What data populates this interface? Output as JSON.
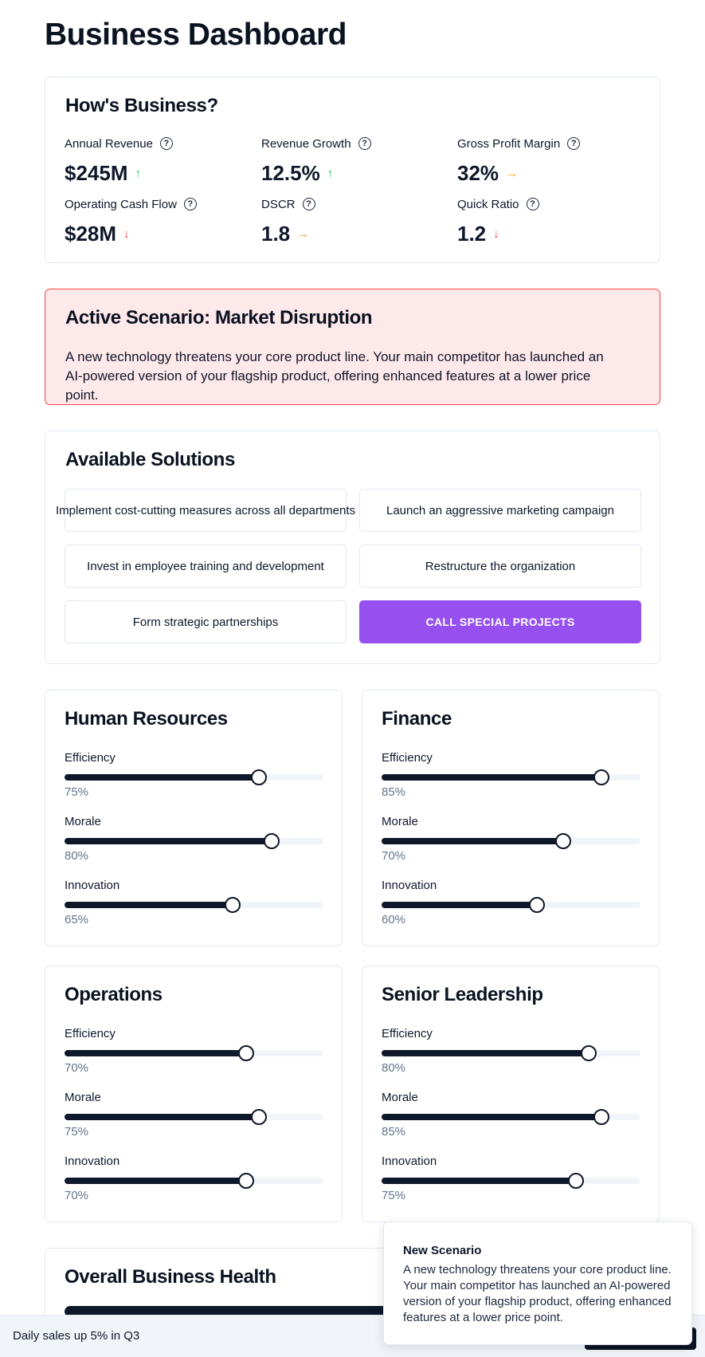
{
  "page": {
    "title": "Business Dashboard"
  },
  "metrics": {
    "title": "How's Business?",
    "items": [
      {
        "label": "Annual Revenue",
        "value": "$245M",
        "trend": "up",
        "arrow": "↑"
      },
      {
        "label": "Revenue Growth",
        "value": "12.5%",
        "trend": "up",
        "arrow": "↑"
      },
      {
        "label": "Gross Profit Margin",
        "value": "32%",
        "trend": "flat",
        "arrow": "→"
      },
      {
        "label": "Operating Cash Flow",
        "value": "$28M",
        "trend": "down",
        "arrow": "↓"
      },
      {
        "label": "DSCR",
        "value": "1.8",
        "trend": "flat",
        "arrow": "→"
      },
      {
        "label": "Quick Ratio",
        "value": "1.2",
        "trend": "down",
        "arrow": "↓"
      }
    ],
    "help_glyph": "?"
  },
  "scenario": {
    "title": "Active Scenario: Market Disruption",
    "description": "A new technology threatens your core product line. Your main competitor has launched an AI-powered version of your flagship product, offering enhanced features at a lower price point."
  },
  "solutions": {
    "title": "Available Solutions",
    "options": [
      "Implement cost-cutting measures across all departments",
      "Launch an aggressive marketing campaign",
      "Invest in employee training and development",
      "Restructure the organization",
      "Form strategic partnerships"
    ],
    "special_label": "CALL SPECIAL PROJECTS",
    "special_color": "#9650f0"
  },
  "departments": [
    {
      "name": "Human Resources",
      "stats": [
        {
          "label": "Efficiency",
          "value": 75,
          "display": "75%"
        },
        {
          "label": "Morale",
          "value": 80,
          "display": "80%"
        },
        {
          "label": "Innovation",
          "value": 65,
          "display": "65%"
        }
      ]
    },
    {
      "name": "Finance",
      "stats": [
        {
          "label": "Efficiency",
          "value": 85,
          "display": "85%"
        },
        {
          "label": "Morale",
          "value": 70,
          "display": "70%"
        },
        {
          "label": "Innovation",
          "value": 60,
          "display": "60%"
        }
      ]
    },
    {
      "name": "Operations",
      "stats": [
        {
          "label": "Efficiency",
          "value": 70,
          "display": "70%"
        },
        {
          "label": "Morale",
          "value": 75,
          "display": "75%"
        },
        {
          "label": "Innovation",
          "value": 70,
          "display": "70%"
        }
      ]
    },
    {
      "name": "Senior Leadership",
      "stats": [
        {
          "label": "Efficiency",
          "value": 80,
          "display": "80%"
        },
        {
          "label": "Morale",
          "value": 85,
          "display": "85%"
        },
        {
          "label": "Innovation",
          "value": 75,
          "display": "75%"
        }
      ]
    }
  ],
  "health": {
    "title": "Overall Business Health"
  },
  "ticker": {
    "text": "Daily sales up 5% in Q3"
  },
  "toast": {
    "title": "New Scenario",
    "body": "A new technology threatens your core product line. Your main competitor has launched an AI-powered version of your flagship product, offering enhanced features at a lower price point."
  },
  "colors": {
    "up": "#22c55e",
    "down": "#ef4444",
    "flat": "#f59e0b",
    "scenario_bg": "#fde8ea",
    "slider": "#0f172a"
  }
}
